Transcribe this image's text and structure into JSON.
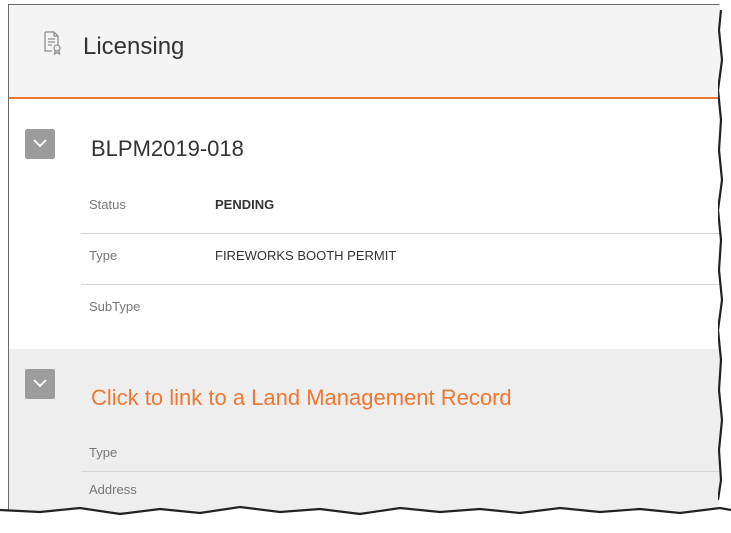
{
  "header": {
    "title": "Licensing",
    "icon": "license-document-icon"
  },
  "record": {
    "id": "BLPM2019-018",
    "fields": [
      {
        "label": "Status",
        "value": "PENDING"
      },
      {
        "label": "Type",
        "value": "FIREWORKS BOOTH PERMIT"
      },
      {
        "label": "SubType",
        "value": ""
      }
    ]
  },
  "land_management": {
    "link_text": "Click to link to a Land Management Record",
    "fields": [
      {
        "label": "Type",
        "value": ""
      },
      {
        "label": "Address",
        "value": ""
      }
    ]
  },
  "colors": {
    "accent": "#ee7731",
    "toggle_bg": "#9c9c9c",
    "panel_bg": "#eeeeee",
    "header_bg": "#f4f4f4"
  }
}
